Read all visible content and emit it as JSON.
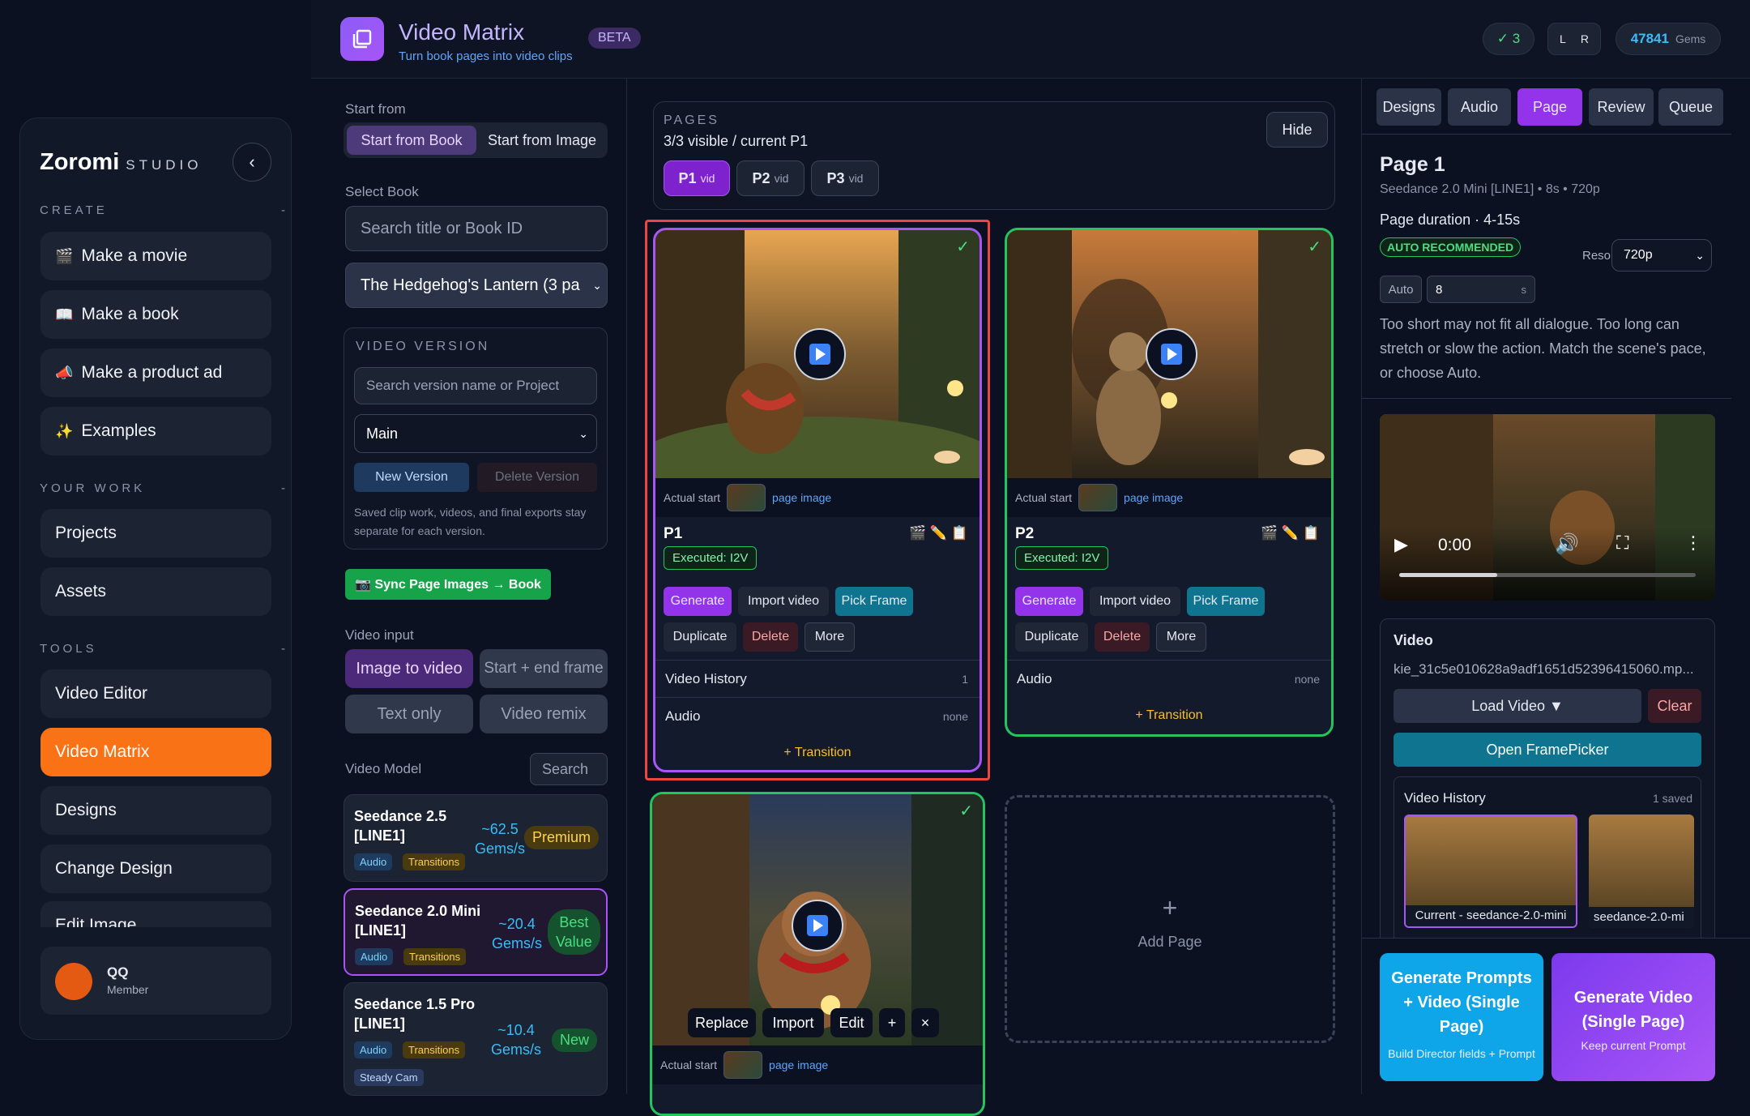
{
  "sidebar": {
    "brand": "Zoromi",
    "brand_sub": "STUDIO",
    "collapse_icon": "‹",
    "sections": {
      "create": "CREATE",
      "work": "YOUR WORK",
      "tools": "TOOLS",
      "dash": "-"
    },
    "create_items": [
      {
        "icon": "🎬",
        "label": "Make a movie"
      },
      {
        "icon": "📖",
        "label": "Make a book"
      },
      {
        "icon": "📣",
        "label": "Make a product ad"
      },
      {
        "icon": "✨",
        "label": "Examples"
      }
    ],
    "work_items": [
      "Projects",
      "Assets"
    ],
    "tool_items": [
      "Video Editor",
      "Video Matrix",
      "Designs",
      "Change Design",
      "Edit Image"
    ],
    "user": {
      "name": "QQ",
      "role": "Member"
    }
  },
  "header": {
    "title": "Video Matrix",
    "subtitle": "Turn book pages into video clips",
    "badge": "BETA",
    "status": "✓ 3",
    "l": "L",
    "r": "R",
    "gems": "47841",
    "gems_label": "Gems"
  },
  "left": {
    "start_from": "Start from",
    "start_book": "Start from Book",
    "start_image": "Start from Image",
    "select_book": "Select Book",
    "search_placeholder": "Search title or Book ID",
    "book_selected": "The Hedgehog's Lantern (3 pa",
    "version_title": "VIDEO VERSION",
    "version_placeholder": "Search version name or Project",
    "version_selected": "Main",
    "new_version": "New Version",
    "delete_version": "Delete Version",
    "version_note": "Saved clip work, videos, and final exports stay separate for each version.",
    "sync": "📷 Sync Page Images → Book",
    "video_input": "Video input",
    "inputs": [
      "Image to video",
      "Start + end frame",
      "Text only",
      "Video remix"
    ],
    "model_label": "Video Model",
    "model_search": "Search",
    "models": [
      {
        "name1": "Seedance 2.5",
        "name2": "[LINE1]",
        "price1": "~62.5",
        "price2": "Gems/s",
        "badge": "Premium",
        "tags": [
          "Audio",
          "Transitions"
        ]
      },
      {
        "name1": "Seedance 2.0 Mini",
        "name2": "[LINE1]",
        "price1": "~20.4",
        "price2": "Gems/s",
        "badge1": "Best",
        "badge2": "Value",
        "tags": [
          "Audio",
          "Transitions"
        ]
      },
      {
        "name1": "Seedance 1.5 Pro",
        "name2": "[LINE1]",
        "price1": "~10.4",
        "price2": "Gems/s",
        "badge": "New",
        "tags": [
          "Audio",
          "Transitions",
          "Steady Cam"
        ]
      }
    ]
  },
  "center": {
    "pages_label": "PAGES",
    "pages_info": "3/3 visible / current P1",
    "hide": "Hide",
    "page_tabs": [
      {
        "p": "P1",
        "v": "vid"
      },
      {
        "p": "P2",
        "v": "vid"
      },
      {
        "p": "P3",
        "v": "vid"
      }
    ],
    "actual_start": "Actual start",
    "page_image": "page image",
    "executed": "Executed: I2V",
    "actions": [
      "Generate",
      "Import video",
      "Pick Frame",
      "Duplicate",
      "Delete",
      "More"
    ],
    "video_history": "Video History",
    "vh_count": "1",
    "audio": "Audio",
    "none": "none",
    "transition": "+ Transition",
    "p1": "P1",
    "p2": "P2",
    "overlay": [
      "Replace",
      "Import",
      "Edit",
      "+",
      "×"
    ],
    "add_plus": "+",
    "add_page": "Add Page",
    "check": "✓"
  },
  "right": {
    "tabs": [
      "Designs",
      "Audio",
      "Page",
      "Review",
      "Queue"
    ],
    "page_title": "Page 1",
    "page_meta": "Seedance 2.0 Mini [LINE1] • 8s • 720p",
    "duration": "Page duration · 4-15s",
    "auto_rec": "AUTO RECOMMENDED",
    "resolution": "Resolution",
    "res_value": "720p",
    "auto": "Auto",
    "dur_value": "8",
    "unit": "s",
    "help": "Too short may not fit all dialogue. Too long can stretch or slow the action. Match the scene's pace, or choose Auto.",
    "time": "0:00",
    "video_label": "Video",
    "video_file": "kie_31c5e010628a9adf1651d52396415060.mp...",
    "load_video": "Load Video ▼",
    "clear": "Clear",
    "open_fp": "Open FramePicker",
    "history": "Video History",
    "history_count": "1 saved",
    "hist1": "Current - seedance-2.0-mini",
    "hist2": "seedance-2.0-mi",
    "gen_prompts": "Generate Prompts + Video (Single Page)",
    "gen_prompts_sub": "Build Director fields + Prompt",
    "gen_video": "Generate Video (Single Page)",
    "gen_video_sub": "Keep current Prompt"
  }
}
